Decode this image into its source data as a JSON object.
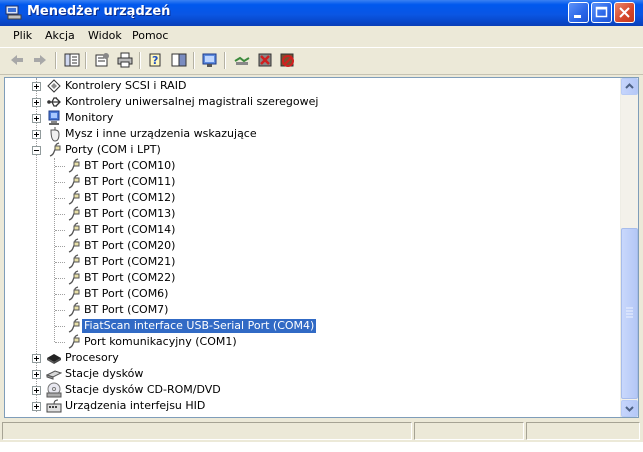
{
  "window": {
    "title": "Menedżer urządzeń"
  },
  "menu": [
    "Plik",
    "Akcja",
    "Widok",
    "Pomoc"
  ],
  "toolbar": {
    "icons": [
      "back-arrow-icon",
      "forward-arrow-icon",
      "tree-view-icon",
      "properties-icon",
      "print-icon",
      "help-icon",
      "console-pane-icon",
      "scan-hardware-icon",
      "update-driver-icon",
      "uninstall-icon",
      "disable-icon"
    ]
  },
  "tree": {
    "categories_top": [
      {
        "label": "Kontrolery SCSI i RAID",
        "icon": "scsi-icon"
      },
      {
        "label": "Kontrolery uniwersalnej magistrali szeregowej",
        "icon": "usb-icon"
      },
      {
        "label": "Monitory",
        "icon": "monitor-icon"
      },
      {
        "label": "Mysz i inne urządzenia wskazujące",
        "icon": "mouse-icon"
      }
    ],
    "ports": {
      "label": "Porty (COM i LPT)",
      "icon": "port-icon",
      "children": [
        "BT Port (COM10)",
        "BT Port (COM11)",
        "BT Port (COM12)",
        "BT Port (COM13)",
        "BT Port (COM14)",
        "BT Port (COM20)",
        "BT Port (COM21)",
        "BT Port (COM22)",
        "BT Port (COM6)",
        "BT Port (COM7)",
        "FiatScan interface USB-Serial Port (COM4)",
        "Port komunikacyjny (COM1)"
      ],
      "selected_index": 10
    },
    "categories_bottom": [
      {
        "label": "Procesory",
        "icon": "cpu-icon"
      },
      {
        "label": "Stacje dysków",
        "icon": "floppy-icon"
      },
      {
        "label": "Stacje dysków CD-ROM/DVD",
        "icon": "cdrom-icon"
      },
      {
        "label": "Urządzenia interfejsu HID",
        "icon": "hid-icon"
      }
    ]
  },
  "colors": {
    "titlebar": "#0A56E4",
    "selection": "#316AC5",
    "chrome": "#ECE9D8"
  }
}
